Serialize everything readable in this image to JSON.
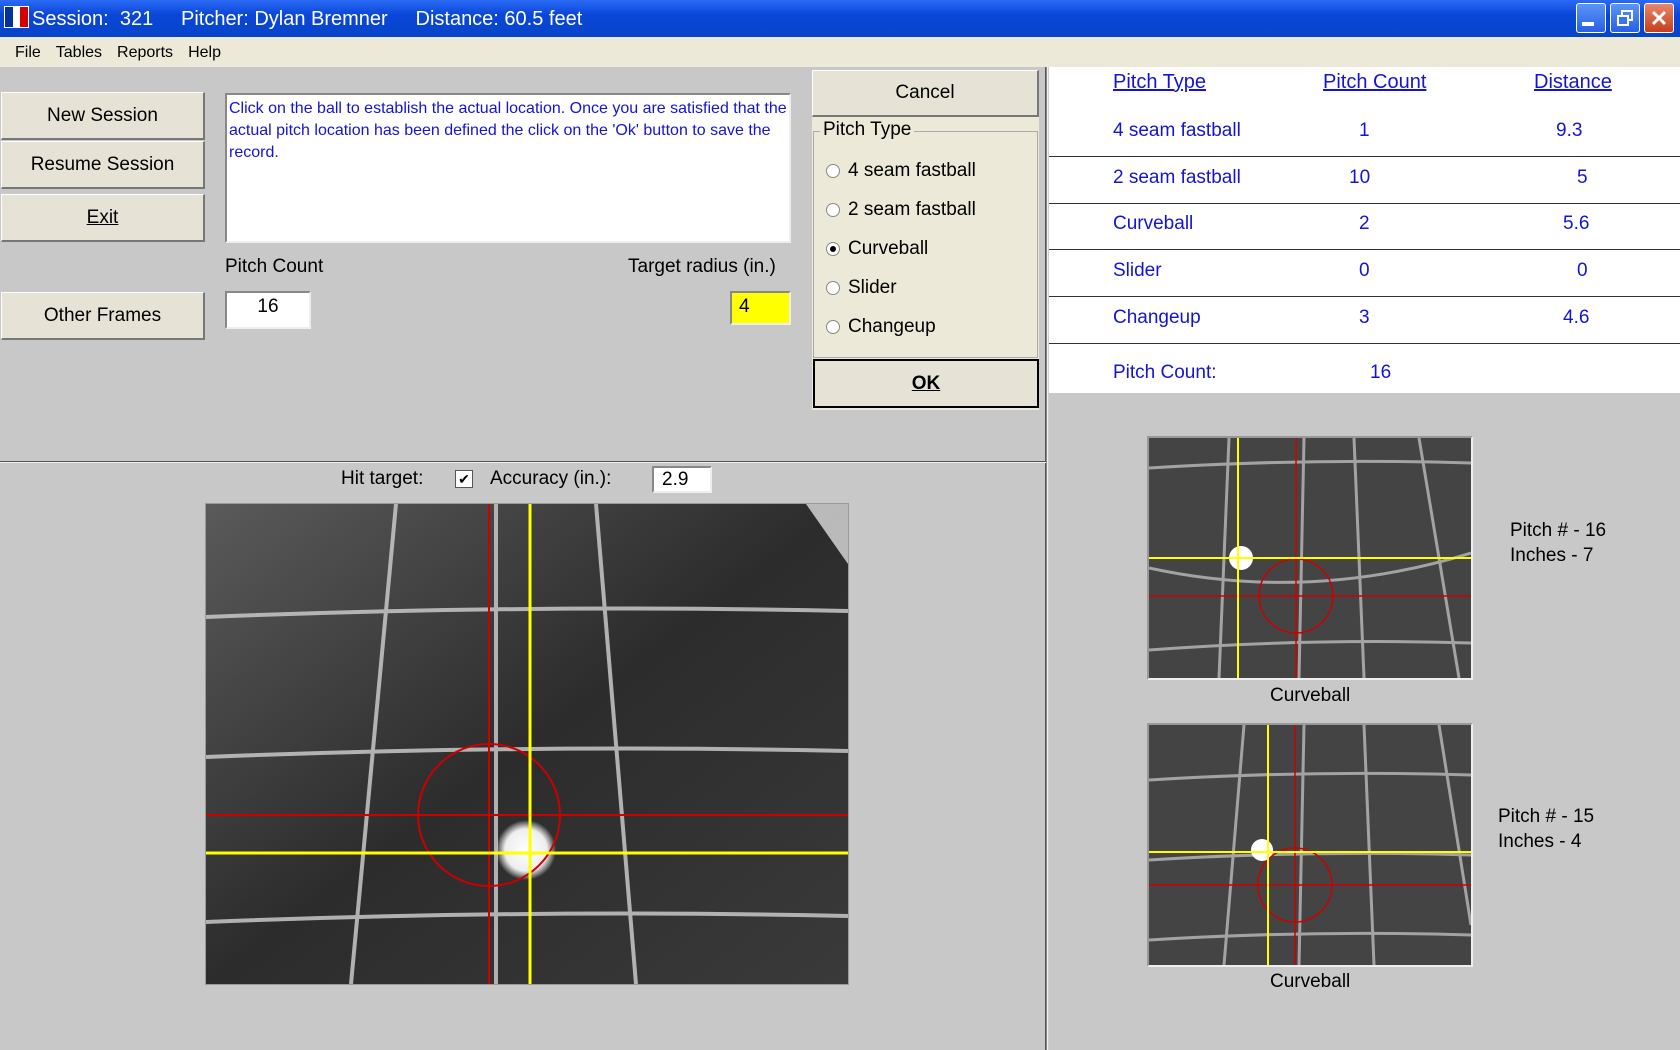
{
  "window": {
    "title": "Session:  321     Pitcher: Dylan Bremner     Distance: 60.5 feet",
    "icon": "flag-icon",
    "icon_colors": [
      "#0033a0",
      "#ffffff",
      "#d20000"
    ]
  },
  "menu": [
    "File",
    "Tables",
    "Reports",
    "Help"
  ],
  "buttons": {
    "new_session": "New Session",
    "resume_session": "Resume Session",
    "exit": "Exit",
    "other_frames": "Other Frames",
    "cancel": "Cancel",
    "ok": "OK"
  },
  "message": "Click on the ball to establish the actual location. Once you are satisfied that the actual pitch location has been defined the click on the 'Ok' button to save the record.",
  "pitch_count": {
    "label": "Pitch Count",
    "value": "16"
  },
  "target_radius": {
    "label": "Target radius (in.)",
    "value": "4"
  },
  "pitch_type": {
    "legend": "Pitch Type",
    "options": [
      "4 seam fastball",
      "2 seam fastball",
      "Curveball",
      "Slider",
      "Changeup"
    ],
    "selected": "Curveball"
  },
  "stats": {
    "headers": [
      "Pitch Type",
      "Pitch Count",
      "Distance"
    ],
    "rows": [
      {
        "type": "4 seam fastball",
        "count": "1",
        "distance": "9.3"
      },
      {
        "type": "2 seam fastball",
        "count": "10",
        "distance": "5"
      },
      {
        "type": "Curveball",
        "count": "2",
        "distance": "5.6"
      },
      {
        "type": "Slider",
        "count": "0",
        "distance": "0"
      },
      {
        "type": "Changeup",
        "count": "3",
        "distance": "4.6"
      }
    ],
    "total_label": "Pitch Count:",
    "total_value": "16"
  },
  "hit_target": {
    "label": "Hit target:",
    "checked": true
  },
  "accuracy": {
    "label": "Accuracy (in.):",
    "value": "2.9"
  },
  "thumbnails": [
    {
      "caption": "Curveball",
      "pitch": "Pitch # - 16",
      "inches": "Inches - 7"
    },
    {
      "caption": "Curveball",
      "pitch": "Pitch # - 15",
      "inches": "Inches - 4"
    }
  ],
  "colors": {
    "accent_text": "#1414d2",
    "target_field": "#ffff00",
    "target_circle": "#cc0000",
    "crosshair": "#ffff00"
  }
}
